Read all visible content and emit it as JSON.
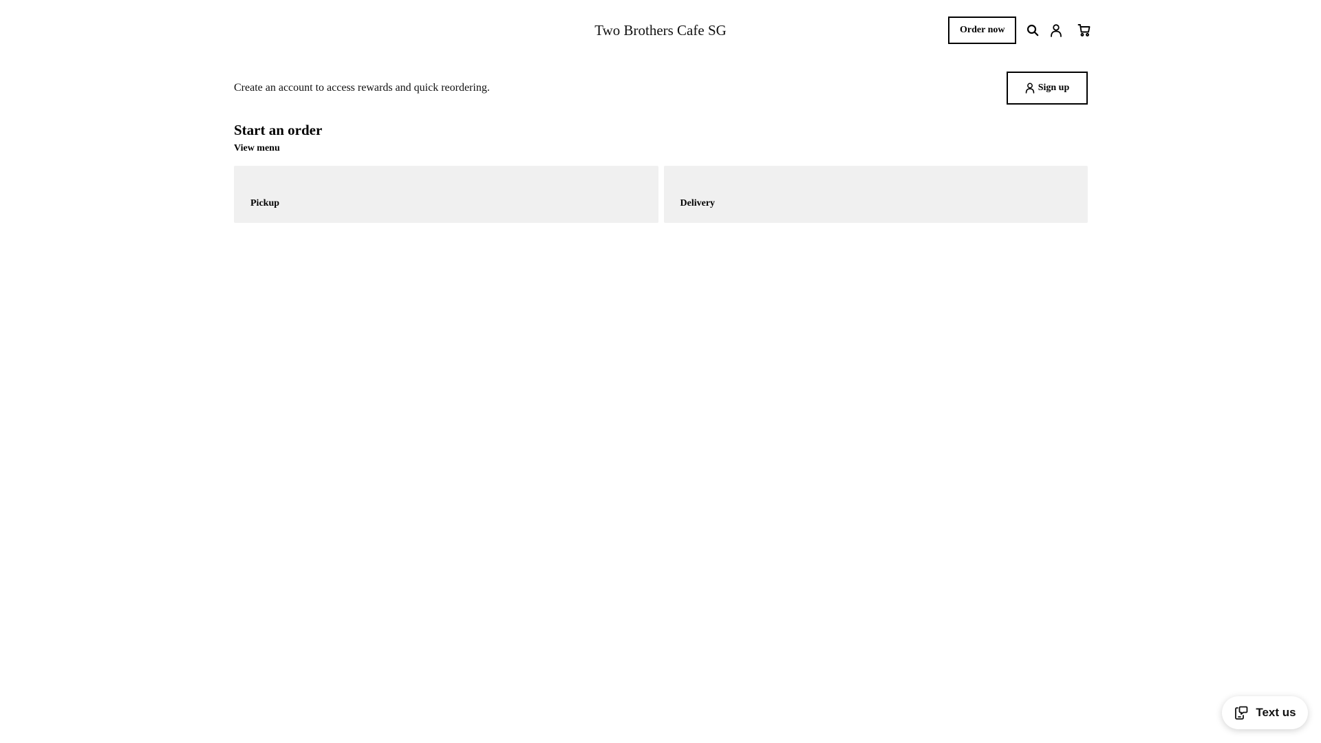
{
  "header": {
    "site_title": "Two Brothers Cafe SG",
    "order_now_label": "Order now",
    "icons": {
      "search": "search-icon",
      "account": "account-icon",
      "cart": "cart-icon"
    }
  },
  "signup": {
    "prompt": "Create an account to access rewards and quick reordering.",
    "button_label": "Sign up",
    "button_icon": "person-icon"
  },
  "order": {
    "heading": "Start an order",
    "view_menu_label": "View menu",
    "options": [
      {
        "label": "Pickup"
      },
      {
        "label": "Delivery"
      }
    ],
    "card_background": "#f0f0f0"
  },
  "chat_widget": {
    "label": "Text us",
    "icon": "chat-phone-icon"
  }
}
